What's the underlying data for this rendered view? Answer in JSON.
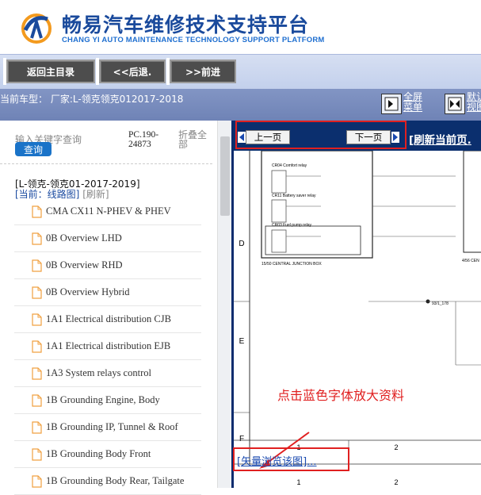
{
  "brand": {
    "title_cn": "畅易汽车维修技术支持平台",
    "title_en": "CHANG YI AUTO MAINTENANCE TECHNOLOGY SUPPORT PLATFORM"
  },
  "nav": {
    "home_label": "返回主目录",
    "back_label": "<<后退.",
    "forward_label": ">>前进"
  },
  "model_bar": {
    "text": "当前车型： 厂家:L-领克领克012017-2018",
    "fullscreen_label": "全屏\n菜单",
    "default_view_label": "默认\n视图"
  },
  "sidebar": {
    "search_placeholder": "输入关键字查询",
    "search_button": "查询",
    "pc_code": "PC.190-24873",
    "collapse_label": "折叠全部",
    "tree_title": "[L-领克-领克01-2017-2019]",
    "current_prefix": "[当前：线路图]",
    "refresh_label": "[刷新]",
    "items": [
      {
        "label": "CMA CX11 N-PHEV & PHEV"
      },
      {
        "label": "0B Overview LHD"
      },
      {
        "label": "0B Overview RHD"
      },
      {
        "label": "0B Overview Hybrid"
      },
      {
        "label": "1A1 Electrical distribution CJB"
      },
      {
        "label": "1A1 Electrical distribution EJB"
      },
      {
        "label": "1A3 System relays control"
      },
      {
        "label": "1B Grounding Engine, Body"
      },
      {
        "label": "1B Grounding IP, Tunnel & Roof"
      },
      {
        "label": "1B Grounding Body Front"
      },
      {
        "label": "1B Grounding Body Rear, Tailgate"
      }
    ]
  },
  "viewer": {
    "prev_page": "上一页",
    "next_page": "下一页",
    "refresh_current": "[刷新当前页.",
    "annotation": "点击蓝色字体放大资料",
    "vector_link": "[矢量浏览该图]...",
    "row_labels": [
      "D",
      "E",
      "F"
    ],
    "col_labels": [
      "1",
      "2"
    ],
    "relays": [
      "CR04 Comfort relay",
      "CR11 Battery saver relay",
      "CR03 Fuel pump relay"
    ],
    "junction_box": "15/50  CENTRAL JUNCTION BOX",
    "edge_label": "4/56 CEN",
    "connector_label": "93/1_178"
  },
  "colors": {
    "brand_blue": "#1a4a9c",
    "nav_button": "#4d4d4d",
    "pager_bar": "#0b2f6e",
    "highlight_red": "#e02020",
    "link_blue": "#1a4ab0"
  }
}
